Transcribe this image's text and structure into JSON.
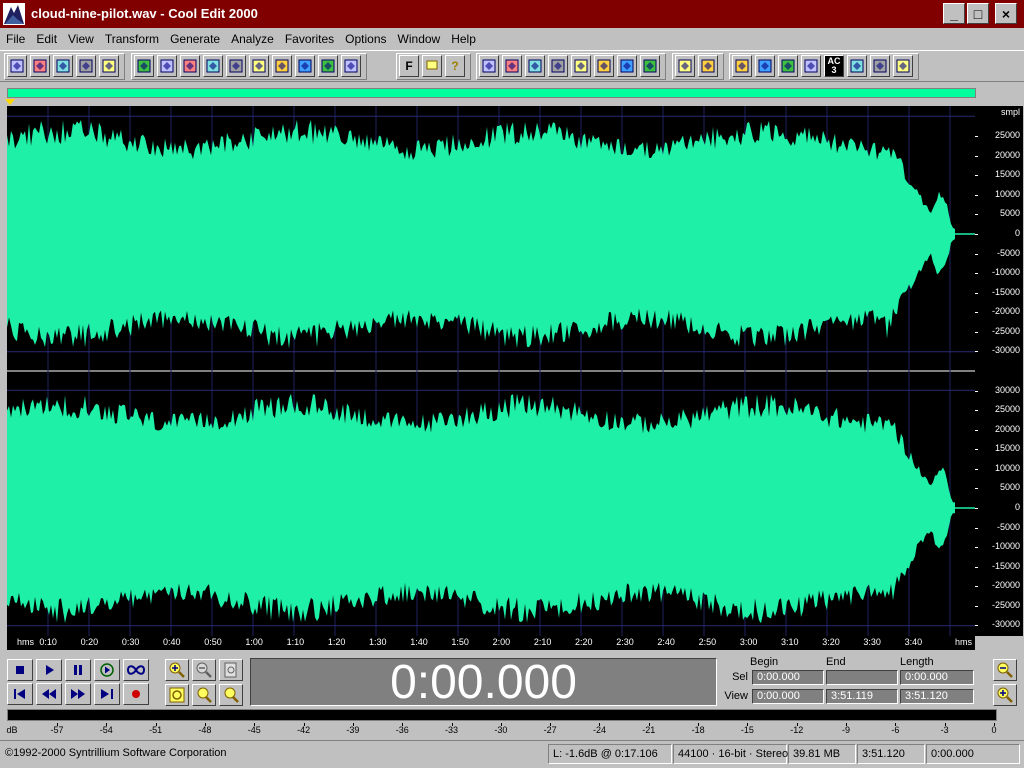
{
  "window": {
    "title": "cloud-nine-pilot.wav - Cool Edit 2000",
    "min_label": "_",
    "max_label": "□",
    "close_label": "×"
  },
  "menu": [
    "File",
    "Edit",
    "View",
    "Transform",
    "Generate",
    "Analyze",
    "Favorites",
    "Options",
    "Window",
    "Help"
  ],
  "toolbar": {
    "group1": [
      "new-icon",
      "open-icon",
      "save-icon",
      "save-as-icon",
      "save-all-icon"
    ],
    "group2": [
      "undo-icon",
      "loop-icon",
      "cut-icon",
      "copy-icon",
      "paste-icon",
      "trim-icon",
      "mix-paste-icon",
      "insert-icon",
      "convert-icon",
      "cd-icon"
    ],
    "text_buttons": {
      "favorites_f": "F",
      "script": "",
      "help": "?"
    },
    "group4": [
      "normalize-icon",
      "reverse-icon",
      "silence-icon",
      "fade-icon",
      "envelope-icon",
      "filter-icon",
      "stretch-icon",
      "noise-icon"
    ],
    "group5": [
      "spectral-icon",
      "grid-icon"
    ],
    "group6": [
      "channel-icon",
      "magnet-icon",
      "stereo-icon",
      "meter-icon",
      "ac3-icon",
      "wave-icon",
      "tuning-icon",
      "note-icon"
    ],
    "ac_label": "AC",
    "ac_sub": "3"
  },
  "waveform": {
    "scale_unit": "smpl",
    "channel_ticks": [
      "30000",
      "25000",
      "20000",
      "15000",
      "10000",
      "5000",
      "0",
      "-5000",
      "-10000",
      "-15000",
      "-20000",
      "-25000",
      "-30000"
    ],
    "top_ticks": [
      "25000",
      "20000",
      "15000",
      "10000",
      "5000",
      "0",
      "-5000",
      "-10000",
      "-15000",
      "-20000",
      "-25000",
      "-30000"
    ],
    "color": "#1ef0a8"
  },
  "ruler": {
    "left_label": "hms",
    "right_label": "hms",
    "labels": [
      "0:10",
      "0:20",
      "0:30",
      "0:40",
      "0:50",
      "1:00",
      "1:10",
      "1:20",
      "1:30",
      "1:40",
      "1:50",
      "2:00",
      "2:10",
      "2:20",
      "2:30",
      "2:40",
      "2:50",
      "3:00",
      "3:10",
      "3:20",
      "3:30",
      "3:40"
    ]
  },
  "time_display": "0:00.000",
  "selection": {
    "headers": {
      "begin": "Begin",
      "end": "End",
      "length": "Length"
    },
    "sel_label": "Sel",
    "view_label": "View",
    "sel": {
      "begin": "0:00.000",
      "end": "",
      "length": "0:00.000"
    },
    "view": {
      "begin": "0:00.000",
      "end": "3:51.119",
      "length": "3:51.120"
    }
  },
  "meter": {
    "unit": "dB",
    "labels": [
      "-57",
      "-54",
      "-51",
      "-48",
      "-45",
      "-42",
      "-39",
      "-36",
      "-33",
      "-30",
      "-27",
      "-24",
      "-21",
      "-18",
      "-15",
      "-12",
      "-9",
      "-6",
      "-3",
      "0"
    ]
  },
  "status": {
    "copyright": "©1992-2000 Syntrillium Software Corporation",
    "level": "L: -1.6dB @  0:17.106",
    "format": "44100 · 16-bit · Stereo",
    "size": "39.81 MB",
    "duration": "3:51.120",
    "position": "0:00.000"
  }
}
